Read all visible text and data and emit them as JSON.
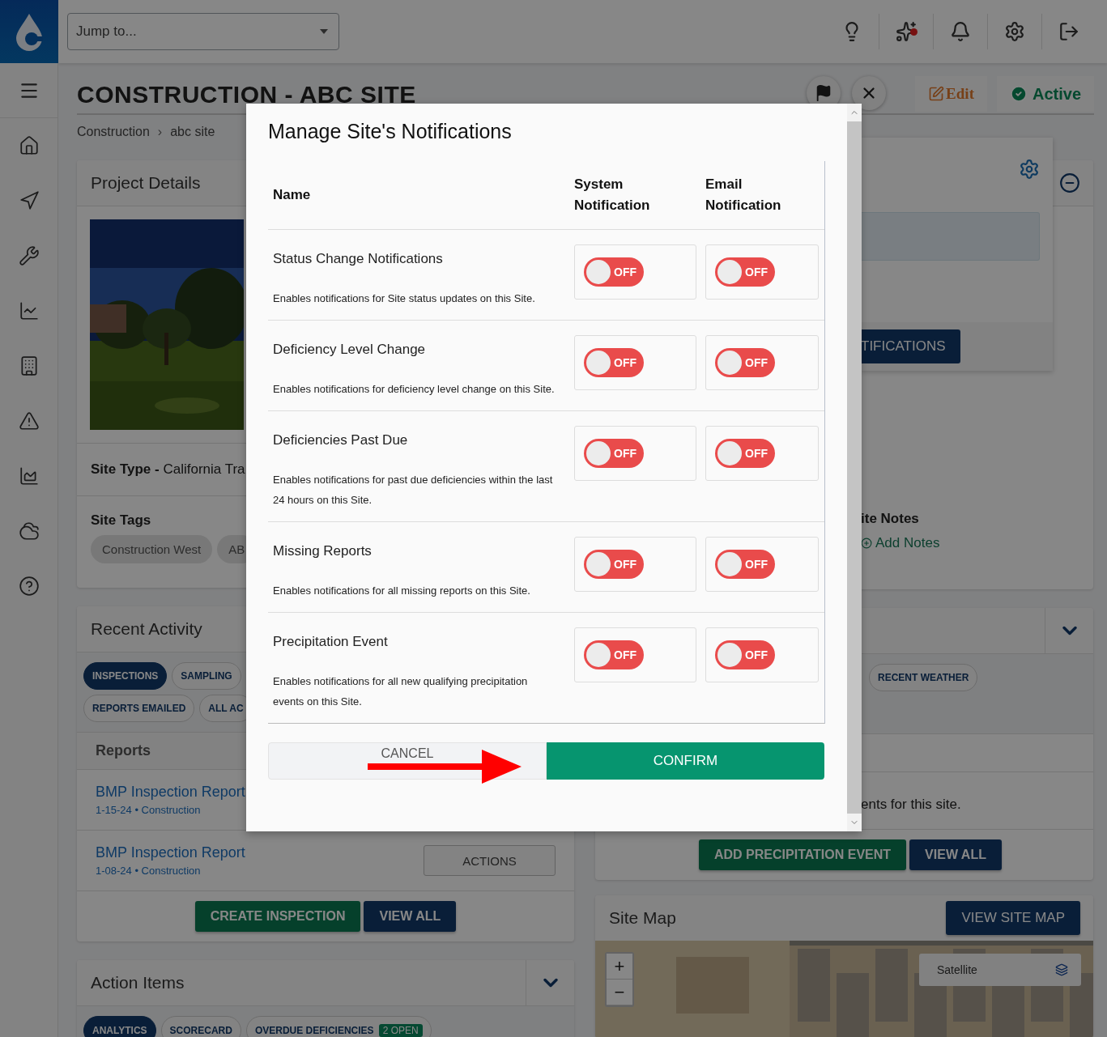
{
  "top_bar": {
    "search": {
      "placeholder": "Jump to..."
    }
  },
  "page": {
    "title": "CONSTRUCTION - ABC SITE",
    "breadcrumb": [
      "Construction",
      "abc site"
    ],
    "breadcrumb_separator": "›",
    "edit": "Edit",
    "status": "Active"
  },
  "project_details": {
    "title": "Project Details",
    "photo": {
      "kind": "picture"
    },
    "site_type_label": "Site Type - ",
    "site_type_value": "California Tra",
    "site_tags_label": "Site Tags",
    "tags": [
      "Construction West",
      "AB"
    ]
  },
  "recent_activity": {
    "title": "Recent Activity",
    "filters": [
      {
        "label": "INSPECTIONS",
        "selected": true
      },
      {
        "label": "SAMPLING",
        "selected": false
      },
      {
        "label": "REPORTS EMAILED",
        "selected": false
      },
      {
        "label": "ALL AC",
        "selected": false
      }
    ],
    "section": "Reports",
    "reports": [
      {
        "title": "BMP Inspection Report",
        "meta": "1-15-24 • Construction"
      },
      {
        "title": "BMP Inspection Report",
        "meta": "1-08-24 • Construction",
        "action": "ACTIONS"
      }
    ],
    "buttons": [
      "CREATE INSPECTION",
      "VIEW ALL"
    ]
  },
  "action_items": {
    "title": "Action Items",
    "filters": [
      {
        "label": "ANALYTICS",
        "selected": true
      },
      {
        "label": "SCORECARD",
        "selected": false
      },
      {
        "label": "OVERDUE DEFICIENCIES",
        "badge": "2 OPEN",
        "selected": false
      }
    ]
  },
  "notifications_popover": {
    "button": "TIFICATIONS"
  },
  "site_notes": {
    "title": "ite Notes",
    "link": "Add Notes"
  },
  "precipitation": {
    "filters": [
      {
        "label": "RECENT WEATHER",
        "selected": false
      }
    ],
    "message": "ents for this site.",
    "buttons": [
      "ADD PRECIPITATION EVENT",
      "VIEW ALL"
    ]
  },
  "site_map": {
    "title": "Site Map",
    "button": "VIEW SITE MAP",
    "map_type": "Satellite",
    "zoom_in": "+",
    "zoom_out": "−"
  },
  "modal": {
    "title": "Manage Site's Notifications",
    "columns": [
      "Name",
      "System Notification",
      "Email Notification"
    ],
    "rows": [
      {
        "name": "Status Change Notifications",
        "description": "Enables notifications for Site status updates on this Site.",
        "system": {
          "on": false,
          "label": "OFF"
        },
        "email": {
          "on": false,
          "label": "OFF"
        }
      },
      {
        "name": "Deficiency Level Change",
        "description": "Enables notifications for deficiency level change on this Site.",
        "system": {
          "on": false,
          "label": "OFF"
        },
        "email": {
          "on": false,
          "label": "OFF"
        }
      },
      {
        "name": "Deficiencies Past Due",
        "description": "Enables notifications for past due deficiencies within the last 24 hours on this Site.",
        "system": {
          "on": false,
          "label": "OFF"
        },
        "email": {
          "on": false,
          "label": "OFF"
        }
      },
      {
        "name": "Missing Reports",
        "description": "Enables notifications for all missing reports on this Site.",
        "system": {
          "on": false,
          "label": "OFF"
        },
        "email": {
          "on": false,
          "label": "OFF"
        }
      },
      {
        "name": "Precipitation Event",
        "description": "Enables notifications for all new qualifying precipitation events on this Site.",
        "system": {
          "on": false,
          "label": "OFF"
        },
        "email": {
          "on": false,
          "label": "OFF"
        }
      }
    ],
    "cancel": "CANCEL",
    "confirm": "CONFIRM"
  }
}
